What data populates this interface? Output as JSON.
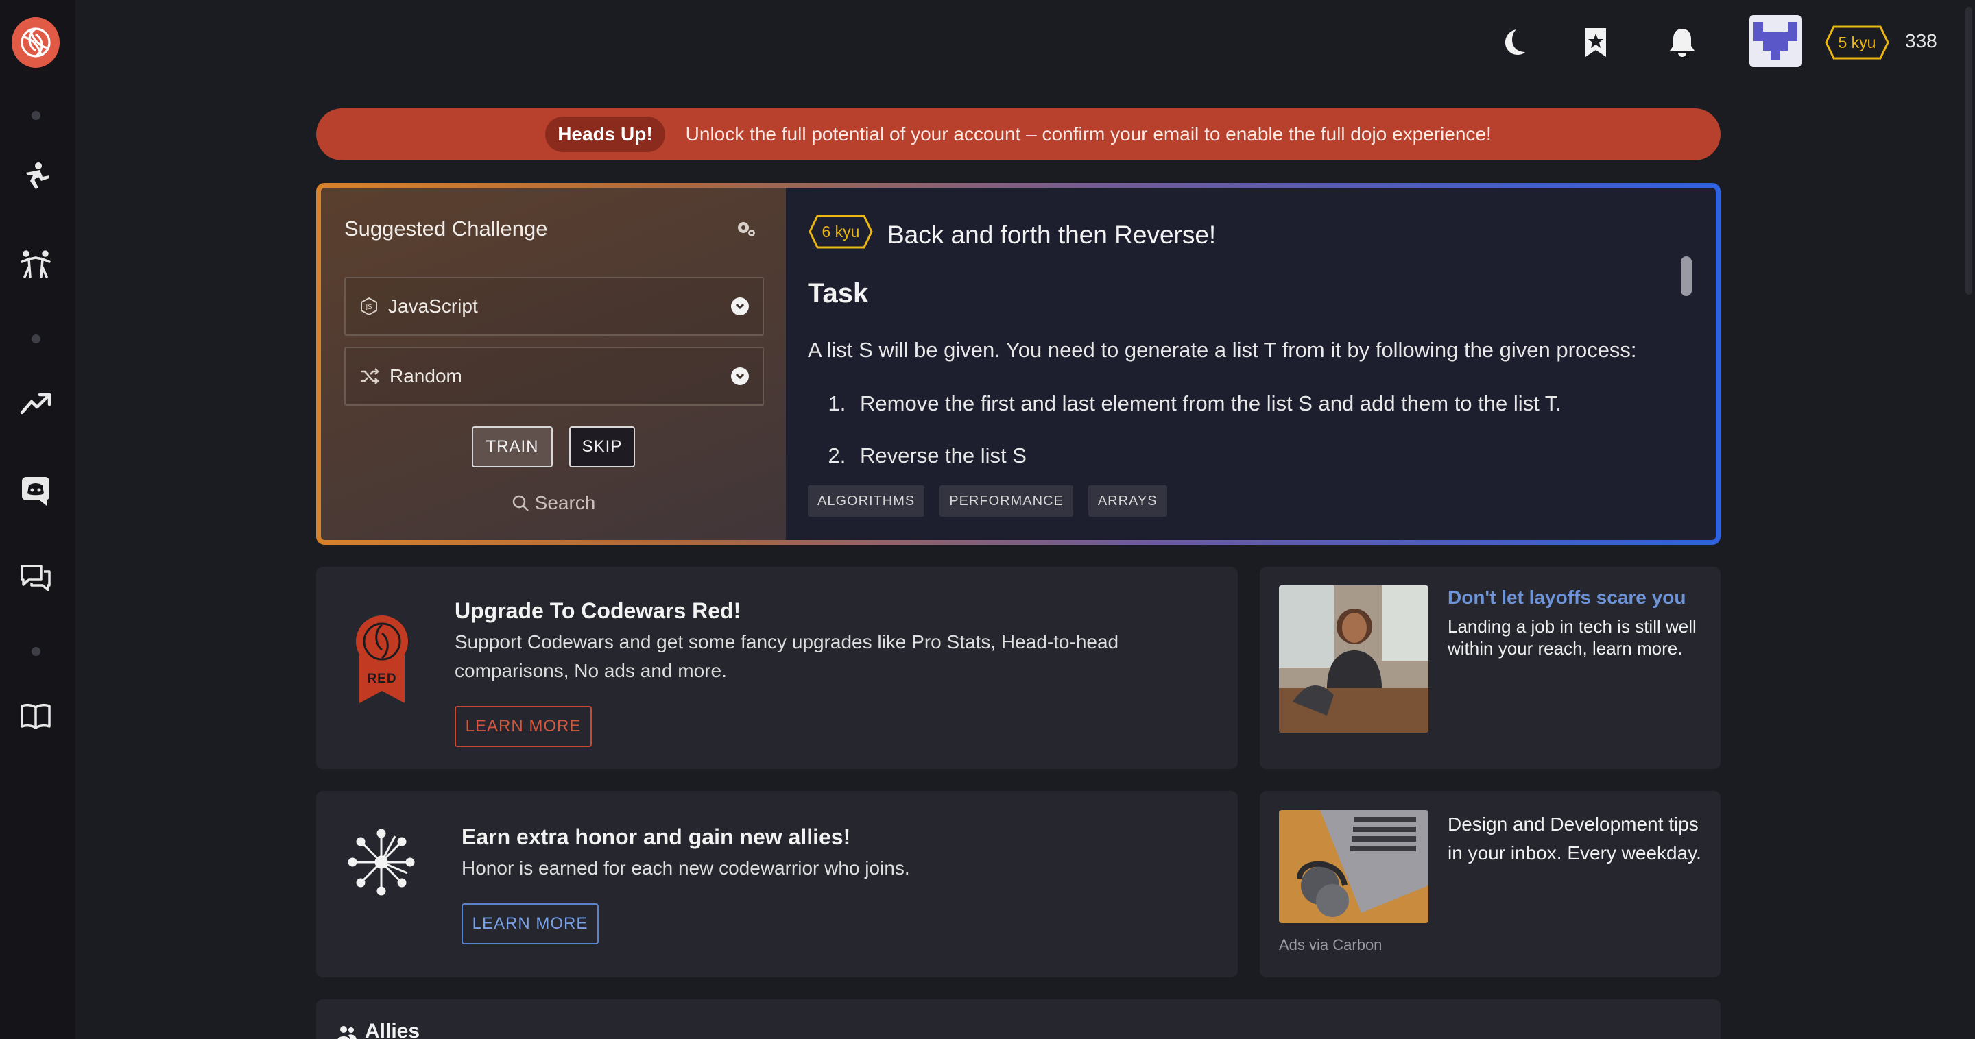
{
  "topbar": {
    "rank": "5 kyu",
    "honor": "338",
    "icons": [
      "moon-icon",
      "bookmark-star-icon",
      "bell-icon"
    ]
  },
  "banner": {
    "pill": "Heads Up!",
    "message": "Unlock the full potential of your account – confirm your email to enable the full dojo experience!"
  },
  "challenge": {
    "heading": "Suggested Challenge",
    "language": "JavaScript",
    "mode": "Random",
    "train_label": "TRAIN",
    "skip_label": "SKIP",
    "search_label": "Search",
    "kata": {
      "rank": "6 kyu",
      "title": "Back and forth then Reverse!",
      "section": "Task",
      "intro": "A list S will be given. You need to generate a list T from it by following the given process:",
      "steps": [
        "Remove the first and last element from the list S and add them to the list T.",
        "Reverse the list S"
      ],
      "tags": [
        "ALGORITHMS",
        "PERFORMANCE",
        "ARRAYS"
      ]
    }
  },
  "promo_red": {
    "badge_text": "RED",
    "title": "Upgrade To Codewars Red!",
    "text": "Support Codewars and get some fancy upgrades like Pro Stats, Head-to-head comparisons, No ads and more.",
    "button": "LEARN MORE"
  },
  "promo_allies": {
    "title": "Earn extra honor and gain new allies!",
    "text": "Honor is earned for each new codewarrior who joins.",
    "button": "LEARN MORE"
  },
  "ad1": {
    "headline": "Don't let layoffs scare you",
    "text": "Landing a job in tech is still well within your reach, learn more."
  },
  "ad2": {
    "text": "Design and Development tips in your inbox. Every weekday.",
    "via": "Ads via Carbon"
  },
  "allies": {
    "title": "Allies"
  },
  "colors": {
    "accent_red": "#b8412d",
    "rank_yellow": "#ecb613",
    "link_blue": "#6d93d9",
    "bg": "#1b1c21"
  }
}
